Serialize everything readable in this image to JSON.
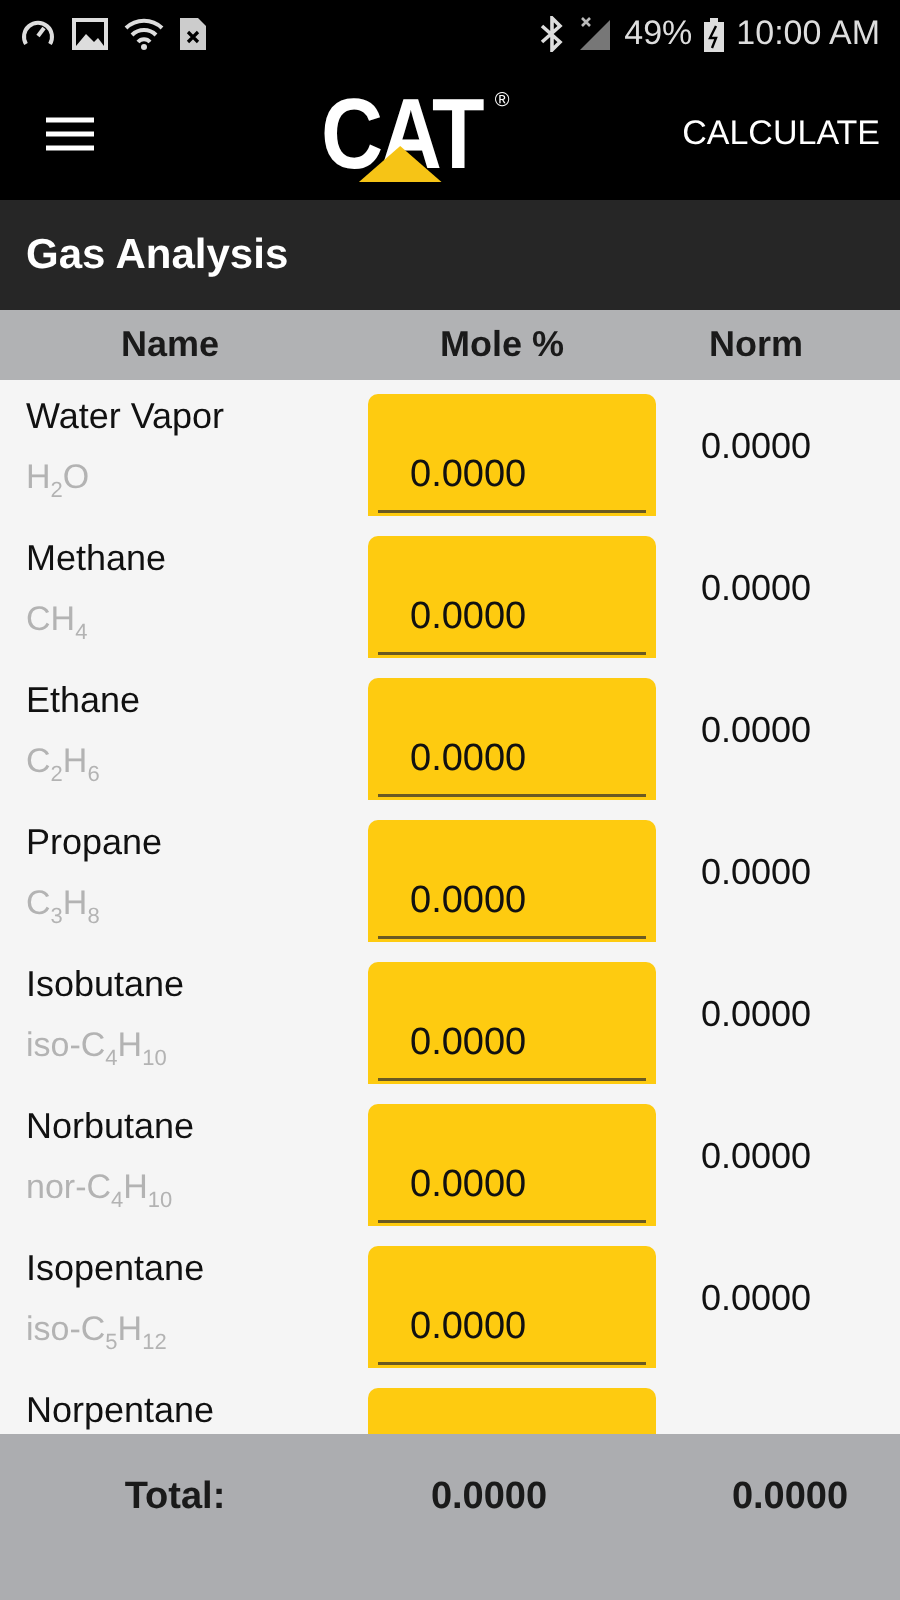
{
  "status_bar": {
    "battery": "49%",
    "time": "10:00 AM"
  },
  "toolbar": {
    "logo": "CAT",
    "logo_mark": "®",
    "action": "CALCULATE"
  },
  "section": {
    "title": "Gas Analysis"
  },
  "table": {
    "columns": [
      "Name",
      "Mole %",
      "Norm"
    ],
    "rows": [
      {
        "name": "Water Vapor",
        "formula": "H$_{2}$O",
        "mole": "0.0000",
        "norm": "0.0000"
      },
      {
        "name": "Methane",
        "formula": "CH$_{4}$",
        "mole": "0.0000",
        "norm": "0.0000"
      },
      {
        "name": "Ethane",
        "formula": "C$_{2}$H$_{6}$",
        "mole": "0.0000",
        "norm": "0.0000"
      },
      {
        "name": "Propane",
        "formula": "C$_{3}$H$_{8}$",
        "mole": "0.0000",
        "norm": "0.0000"
      },
      {
        "name": "Isobutane",
        "formula": "iso-C$_{4}$H$_{10}$",
        "mole": "0.0000",
        "norm": "0.0000"
      },
      {
        "name": "Norbutane",
        "formula": "nor-C$_{4}$H$_{10}$",
        "mole": "0.0000",
        "norm": "0.0000"
      },
      {
        "name": "Isopentane",
        "formula": "iso-C$_{5}$H$_{12}$",
        "mole": "0.0000",
        "norm": "0.0000"
      },
      {
        "name": "Norpentane"
      }
    ]
  },
  "footer": {
    "label": "Total:",
    "mole_total": "0.0000",
    "norm_total": "0.0000"
  }
}
